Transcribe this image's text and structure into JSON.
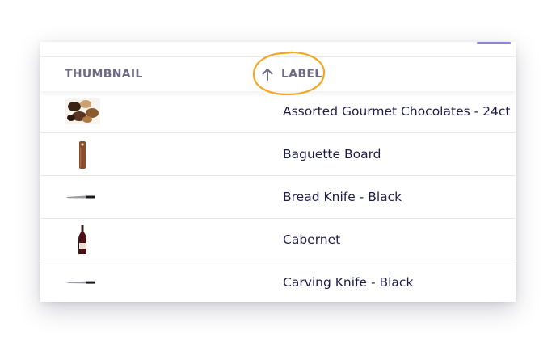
{
  "table": {
    "columns": {
      "thumbnail": "THUMBNAIL",
      "label": "LABEL"
    },
    "sort": {
      "column": "label",
      "direction": "ascending",
      "icon": "arrow-up-icon"
    },
    "highlight_color": "#f5a623",
    "rows": [
      {
        "label": "Assorted Gourmet Chocolates - 24ct",
        "thumbnail_icon": "chocolates-thumbnail"
      },
      {
        "label": "Baguette Board",
        "thumbnail_icon": "cutting-board-thumbnail"
      },
      {
        "label": "Bread Knife - Black",
        "thumbnail_icon": "knife-thumbnail"
      },
      {
        "label": "Cabernet",
        "thumbnail_icon": "wine-bottle-thumbnail"
      },
      {
        "label": "Carving Knife - Black",
        "thumbnail_icon": "knife-thumbnail"
      }
    ]
  }
}
